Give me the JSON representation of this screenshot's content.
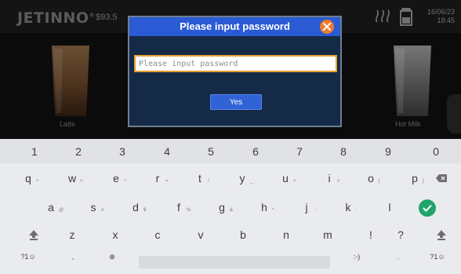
{
  "app": {
    "logo": "JETINNO",
    "balance": "93.5",
    "date": "16/06/23",
    "time": "18:45",
    "products": [
      {
        "label": "Latte"
      },
      {
        "label": "Hot Milk"
      }
    ]
  },
  "dialog": {
    "title": "Please input password",
    "input_placeholder": "Please input password",
    "input_value": "",
    "yes_label": "Yes",
    "colors": {
      "header": "#2a5bd4",
      "body": "#152a47",
      "close": "#f07b2c",
      "input_border": "#e49e32"
    }
  },
  "keyboard": {
    "number_row": [
      "1",
      "2",
      "3",
      "4",
      "5",
      "6",
      "7",
      "8",
      "9",
      "0"
    ],
    "row2": [
      {
        "k": "q",
        "h": "+"
      },
      {
        "k": "w",
        "h": "×"
      },
      {
        "k": "e",
        "h": "÷"
      },
      {
        "k": "r",
        "h": "="
      },
      {
        "k": "t",
        "h": "/"
      },
      {
        "k": "y",
        "h": "_"
      },
      {
        "k": "u",
        "h": "<"
      },
      {
        "k": "i",
        "h": ">"
      },
      {
        "k": "o",
        "h": "["
      },
      {
        "k": "p",
        "h": "]"
      }
    ],
    "row3": [
      {
        "k": "a",
        "h": "@"
      },
      {
        "k": "s",
        "h": "#"
      },
      {
        "k": "d",
        "h": "$"
      },
      {
        "k": "f",
        "h": "%"
      },
      {
        "k": "g",
        "h": "&"
      },
      {
        "k": "h",
        "h": "*"
      },
      {
        "k": "j",
        "h": "-"
      },
      {
        "k": "k",
        "h": "'"
      },
      {
        "k": "l",
        "h": ""
      }
    ],
    "row4": [
      {
        "k": "z",
        "h": ""
      },
      {
        "k": "x",
        "h": ""
      },
      {
        "k": "c",
        "h": ""
      },
      {
        "k": "v",
        "h": ""
      },
      {
        "k": "b",
        "h": ""
      },
      {
        "k": "n",
        "h": ""
      },
      {
        "k": "m",
        "h": ""
      },
      {
        "k": "!",
        "h": ""
      },
      {
        "k": "?",
        "h": ""
      }
    ],
    "symbols_left": "?1☺",
    "comma": ",",
    "globe": "⊕",
    "emoticon": ":-)",
    "period": ".",
    "symbols_right": "?1☺",
    "enter_color": "#1fa56b"
  }
}
